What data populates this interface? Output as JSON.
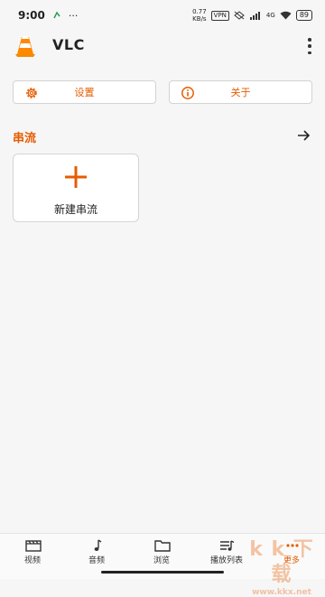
{
  "status_bar": {
    "time": "9:00",
    "speed_value": "0.77",
    "speed_unit": "KB/s",
    "vpn_label": "VPN",
    "signal_label": "4G",
    "battery": "89"
  },
  "app_bar": {
    "title": "VLC"
  },
  "actions": {
    "settings_label": "设置",
    "about_label": "关于"
  },
  "section": {
    "title": "串流"
  },
  "card": {
    "label": "新建串流"
  },
  "bottom_nav": [
    {
      "label": "视频",
      "icon": "video-icon"
    },
    {
      "label": "音频",
      "icon": "music-note-icon"
    },
    {
      "label": "浏览",
      "icon": "folder-icon"
    },
    {
      "label": "播放列表",
      "icon": "playlist-icon"
    },
    {
      "label": "更多",
      "icon": "more-icon",
      "active": true
    }
  ],
  "watermark": {
    "text": "k k 下 载",
    "url": "www.kkx.net"
  },
  "colors": {
    "accent": "#e65c00",
    "background": "#f6f6f7"
  }
}
